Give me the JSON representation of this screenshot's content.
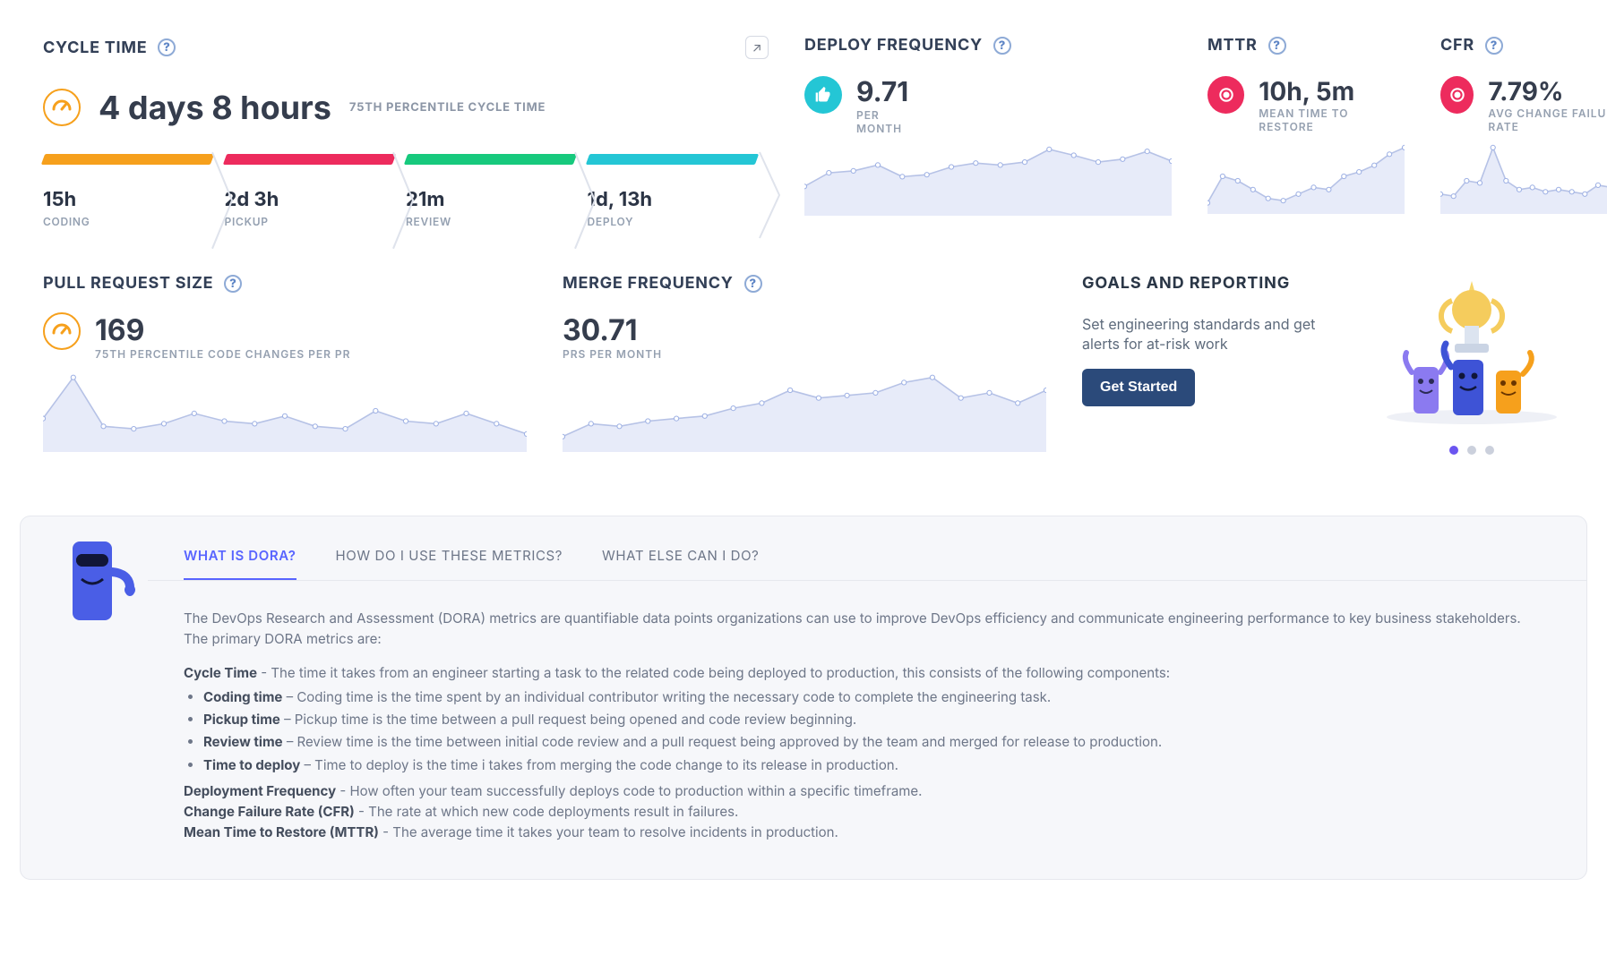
{
  "cycle_time": {
    "title": "CYCLE TIME",
    "value": "4 days 8 hours",
    "subtitle": "75TH PERCENTILE CYCLE TIME",
    "expand_tooltip": "expand",
    "phases": [
      {
        "value": "15h",
        "label": "CODING",
        "color": "#f6a01c"
      },
      {
        "value": "2d 3h",
        "label": "PICKUP",
        "color": "#ed2b5d"
      },
      {
        "value": "21m",
        "label": "REVIEW",
        "color": "#17c97d"
      },
      {
        "value": "1d, 13h",
        "label": "DEPLOY",
        "color": "#24c6d5"
      }
    ]
  },
  "deploy_freq": {
    "title": "DEPLOY FREQUENCY",
    "value": "9.71",
    "sub1": "PER",
    "sub2": "MONTH",
    "badge": "cyan"
  },
  "mttr": {
    "title": "MTTR",
    "value": "10h, 5m",
    "sub": "MEAN TIME TO RESTORE",
    "badge": "pink"
  },
  "cfr": {
    "title": "CFR",
    "value": "7.79%",
    "sub": "AVG CHANGE FAILURE RATE",
    "badge": "pink"
  },
  "pr_size": {
    "title": "PULL REQUEST SIZE",
    "value": "169",
    "sub": "75TH PERCENTILE CODE CHANGES PER PR",
    "badge": "orange"
  },
  "merge": {
    "title": "MERGE FREQUENCY",
    "value": "30.71",
    "sub": "PRS PER MONTH"
  },
  "goals": {
    "title": "GOALS AND REPORTING",
    "desc": "Set engineering standards and get alerts for at-risk work",
    "cta": "Get Started",
    "active_dot": 0,
    "dot_count": 3
  },
  "info": {
    "tabs": [
      "WHAT IS DORA?",
      "HOW DO I USE THESE METRICS?",
      "WHAT ELSE CAN I DO?"
    ],
    "active_tab": 0,
    "intro": "The DevOps Research and Assessment (DORA) metrics are quantifiable data points organizations can use to improve DevOps efficiency and communicate engineering performance to key business stakeholders. The primary DORA metrics are:",
    "ct_lead": " - The time it takes from an engineer starting a task to the related code being deployed to production, this consists of the following components:",
    "bullets": [
      {
        "b": "Coding time",
        "t": " – Coding time is the time spent by an individual contributor writing the necessary code to complete the engineering task."
      },
      {
        "b": "Pickup time",
        "t": " – Pickup time is the time between a pull request being opened and code review beginning."
      },
      {
        "b": "Review time",
        "t": " – Review time is the time between initial code review and a pull request being approved by the team and merged for release to production."
      },
      {
        "b": "Time to deploy",
        "t": " – Time to deploy is the time i takes from merging the code change to its release in production."
      }
    ],
    "defs": [
      {
        "b": "Deployment Frequency",
        "t": " - How often your team successfully deploys code to production within a specific timeframe."
      },
      {
        "b": "Change Failure Rate (CFR)",
        "t": " - The rate at which new code deployments result in failures."
      },
      {
        "b": "Mean Time to Restore (MTTR)",
        "t": " - The average time it takes your team to resolve incidents in production."
      }
    ],
    "labels": {
      "cycle_time": "Cycle Time"
    }
  },
  "chart_data": [
    {
      "id": "deploy_freq",
      "type": "area",
      "x": [
        0,
        1,
        2,
        3,
        4,
        5,
        6,
        7,
        8,
        9,
        10,
        11,
        12,
        13,
        14,
        15
      ],
      "values": [
        30,
        44,
        46,
        52,
        40,
        42,
        50,
        54,
        52,
        55,
        68,
        62,
        55,
        58,
        66,
        56
      ]
    },
    {
      "id": "mttr",
      "type": "area",
      "x": [
        0,
        1,
        2,
        3,
        4,
        5,
        6,
        7,
        8,
        9,
        10,
        11,
        12,
        13
      ],
      "values": [
        10,
        34,
        30,
        22,
        14,
        12,
        18,
        24,
        22,
        34,
        38,
        44,
        54,
        60
      ]
    },
    {
      "id": "cfr",
      "type": "area",
      "x": [
        0,
        1,
        2,
        3,
        4,
        5,
        6,
        7,
        8,
        9,
        10,
        11,
        12,
        13,
        14,
        15
      ],
      "values": [
        18,
        16,
        30,
        28,
        60,
        30,
        22,
        24,
        20,
        22,
        20,
        18,
        26,
        24,
        28,
        22
      ]
    },
    {
      "id": "pr_size",
      "type": "area",
      "x": [
        0,
        1,
        2,
        3,
        4,
        5,
        6,
        7,
        8,
        9,
        10,
        11,
        12,
        13,
        14,
        15,
        16
      ],
      "values": [
        26,
        58,
        20,
        18,
        22,
        30,
        24,
        22,
        28,
        20,
        18,
        32,
        24,
        22,
        30,
        22,
        14
      ]
    },
    {
      "id": "merge",
      "type": "area",
      "x": [
        0,
        1,
        2,
        3,
        4,
        5,
        6,
        7,
        8,
        9,
        10,
        11,
        12,
        13,
        14,
        15,
        16,
        17
      ],
      "values": [
        12,
        22,
        20,
        24,
        26,
        28,
        34,
        38,
        48,
        42,
        44,
        46,
        54,
        58,
        42,
        46,
        38,
        48
      ]
    }
  ]
}
